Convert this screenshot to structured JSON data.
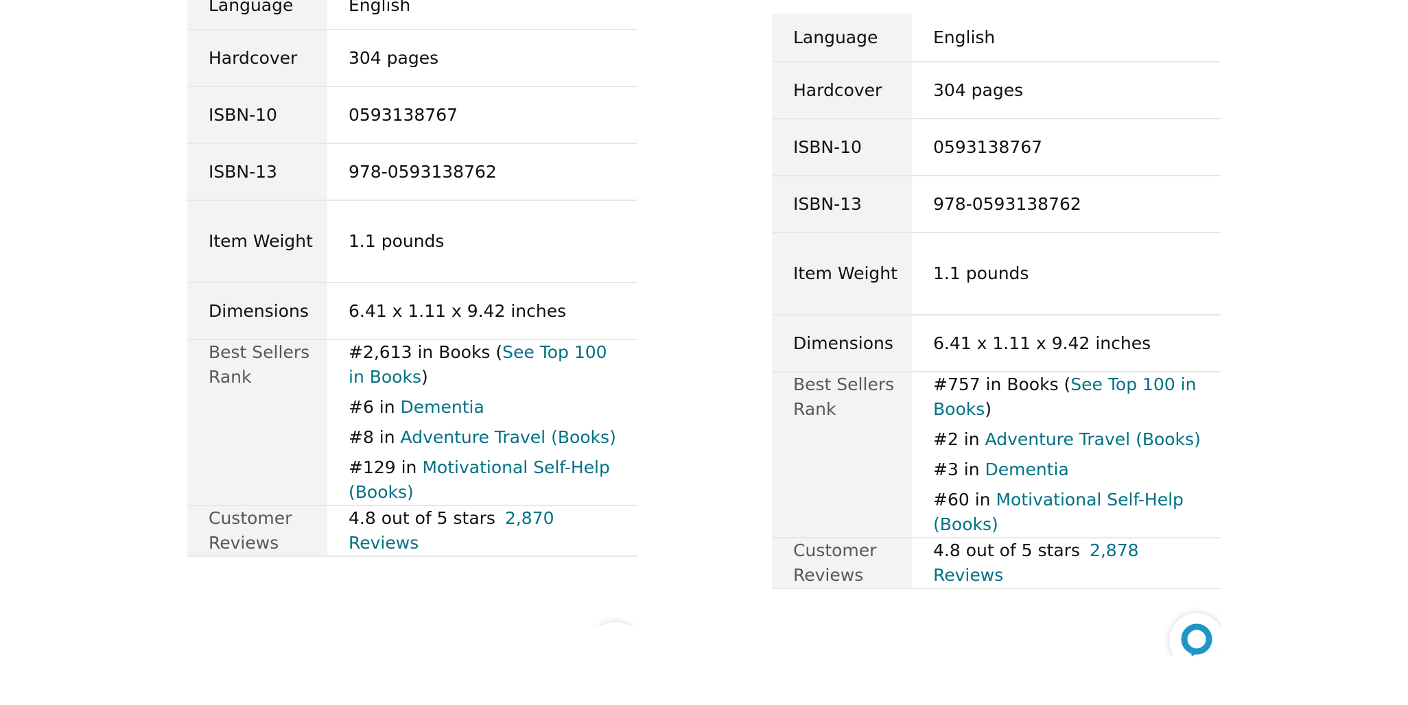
{
  "theme": {
    "link_color": "#007185",
    "label_bg": "#f3f3f3",
    "alexa_color": "#1f97c6"
  },
  "panels": [
    {
      "rows": [
        {
          "label": "Language",
          "value": "English"
        },
        {
          "label": "Hardcover",
          "value": "304 pages"
        },
        {
          "label": "ISBN-10",
          "value": "0593138767"
        },
        {
          "label": "ISBN-13",
          "value": "978-0593138762"
        },
        {
          "label": "Item Weight",
          "value": "1.1 pounds"
        },
        {
          "label": "Dimensions",
          "value": "6.41 x 1.11 x 9.42 inches"
        }
      ],
      "best_sellers": {
        "label": "Best Sellers Rank",
        "items": [
          {
            "prefix": "#2,613 in Books (",
            "link": "See Top 100 in Books",
            "suffix": ")"
          },
          {
            "prefix": "#6 in ",
            "link": "Dementia",
            "suffix": ""
          },
          {
            "prefix": "#8 in ",
            "link": "Adventure Travel (Books)",
            "suffix": ""
          },
          {
            "prefix": "#129 in ",
            "link": "Motivational Self-Help (Books)",
            "suffix": ""
          }
        ]
      },
      "reviews": {
        "label": "Customer Reviews",
        "rating": "4.8 out of 5 stars",
        "count_link": "2,870 Reviews"
      },
      "alexa_icon": "alexa-icon"
    },
    {
      "rows": [
        {
          "label": "Language",
          "value": "English"
        },
        {
          "label": "Hardcover",
          "value": "304 pages"
        },
        {
          "label": "ISBN-10",
          "value": "0593138767"
        },
        {
          "label": "ISBN-13",
          "value": "978-0593138762"
        },
        {
          "label": "Item Weight",
          "value": "1.1 pounds"
        },
        {
          "label": "Dimensions",
          "value": "6.41 x 1.11 x 9.42 inches"
        }
      ],
      "best_sellers": {
        "label": "Best Sellers Rank",
        "items": [
          {
            "prefix": "#757 in Books (",
            "link": "See Top 100 in Books",
            "suffix": ")"
          },
          {
            "prefix": "#2 in ",
            "link": "Adventure Travel (Books)",
            "suffix": ""
          },
          {
            "prefix": "#3 in ",
            "link": "Dementia",
            "suffix": ""
          },
          {
            "prefix": "#60 in ",
            "link": "Motivational Self-Help (Books)",
            "suffix": ""
          }
        ]
      },
      "reviews": {
        "label": "Customer Reviews",
        "rating": "4.8 out of 5 stars",
        "count_link": "2,878 Reviews"
      },
      "alexa_icon": "alexa-icon"
    }
  ]
}
